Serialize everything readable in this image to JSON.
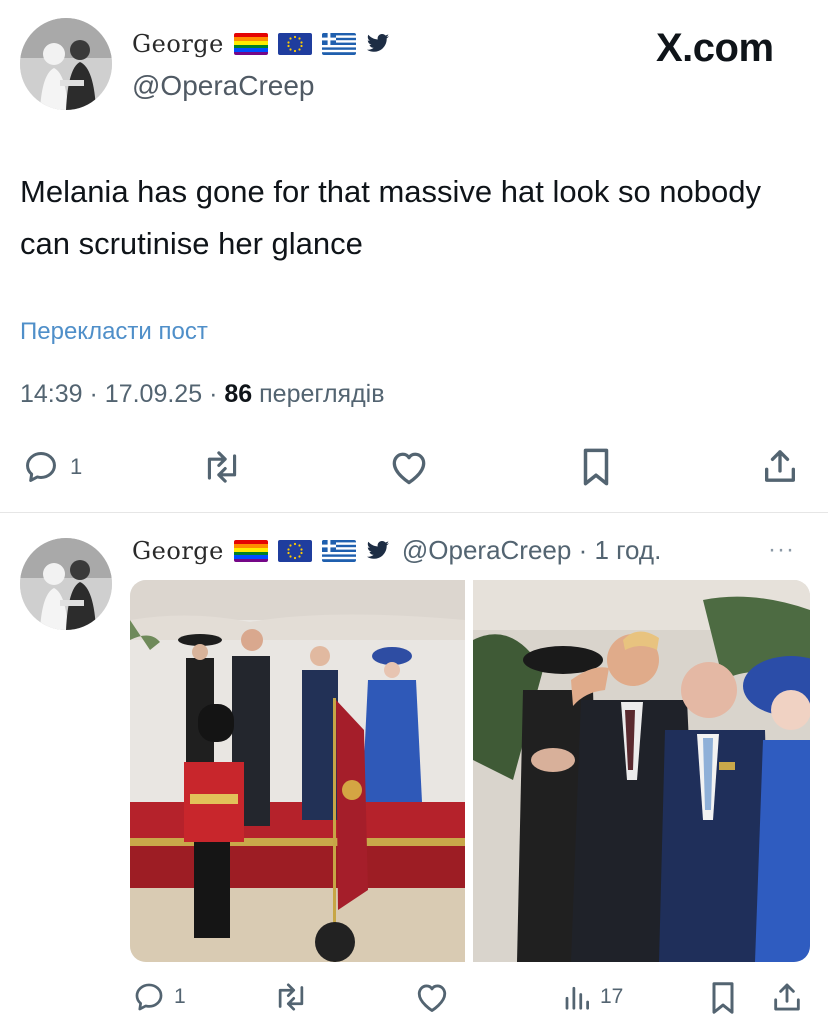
{
  "post": {
    "author": {
      "display_name": "George",
      "handle": "@OperaCreep",
      "badges": [
        "rainbow-flag-icon",
        "eu-flag-icon",
        "greek-flag-icon",
        "twitter-bird-icon"
      ]
    },
    "brand": "X.com",
    "text": "Melania has gone for that massive hat look so nobody can scrutinise her glance",
    "translate_label": "Перекласти пост",
    "time": "14:39",
    "date": "17.09.25",
    "views_count": "86",
    "views_label": "переглядів",
    "separator": "·",
    "actions": {
      "reply_count": "1",
      "icons": [
        "reply-icon",
        "repost-icon",
        "like-icon",
        "bookmark-icon",
        "share-icon"
      ]
    }
  },
  "quoted_post": {
    "author": {
      "display_name": "George",
      "handle_time": "@OperaCreep · 1 год."
    },
    "more_label": "···",
    "photos": [
      "photo-ceremony-wide",
      "photo-salute-closeup"
    ],
    "actions": {
      "reply_count": "1",
      "views_count": "17"
    }
  },
  "colors": {
    "text": "#0f1419",
    "secondary": "#536471",
    "link": "#4f8fc9",
    "divider": "#e6e6e6"
  }
}
